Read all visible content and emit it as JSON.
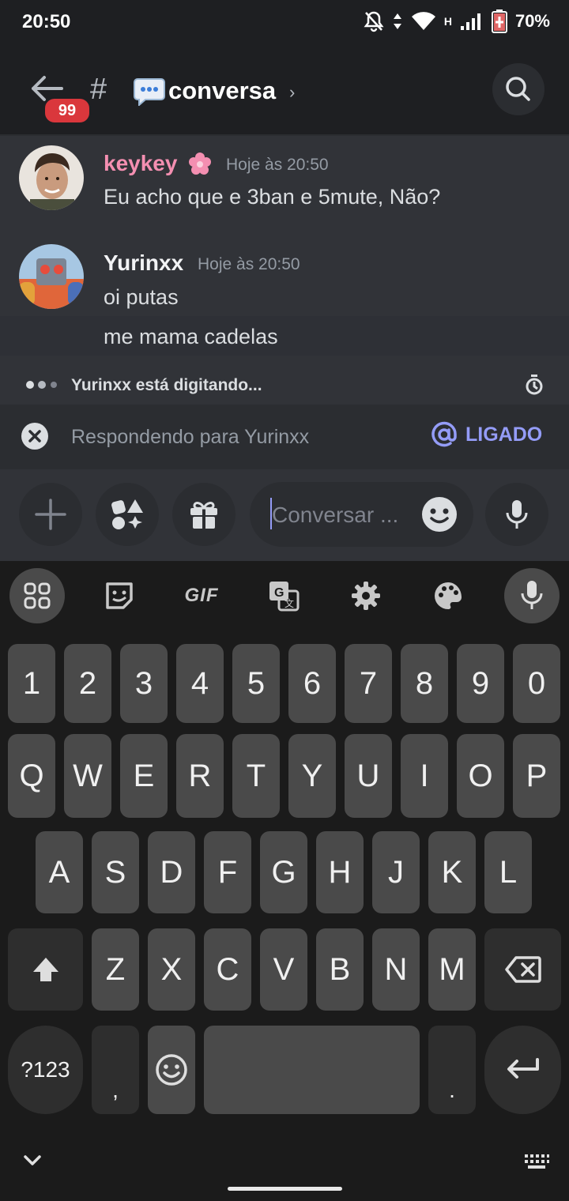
{
  "status_bar": {
    "time": "20:50",
    "network": "H",
    "battery": "70%"
  },
  "header": {
    "badge": "99",
    "hash": "#",
    "channel_name": "conversa",
    "chevron": "›"
  },
  "messages": [
    {
      "author": "keykey",
      "timestamp": "Hoje às 20:50",
      "lines": [
        "Eu acho que e 3ban e 5mute, Não?"
      ],
      "author_color": "#f48fb1"
    },
    {
      "author": "Yurinxx",
      "timestamp": "Hoje às 20:50",
      "lines": [
        "oi putas",
        "me mama cadelas"
      ],
      "author_color": "#f2f3f5"
    }
  ],
  "typing": {
    "text": "Yurinxx está digitando..."
  },
  "reply": {
    "text": "Respondendo para Yurinxx",
    "mention_label": "LIGADO"
  },
  "composer": {
    "placeholder": "Conversar ..."
  },
  "keyboard": {
    "toolbar": [
      "apps-icon",
      "sticker-icon",
      "GIF",
      "translate-icon",
      "settings-icon",
      "palette-icon",
      "mic-icon"
    ],
    "gif_label": "GIF",
    "row_numbers": [
      "1",
      "2",
      "3",
      "4",
      "5",
      "6",
      "7",
      "8",
      "9",
      "0"
    ],
    "row_q": [
      "Q",
      "W",
      "E",
      "R",
      "T",
      "Y",
      "U",
      "I",
      "O",
      "P"
    ],
    "row_a": [
      "A",
      "S",
      "D",
      "F",
      "G",
      "H",
      "J",
      "K",
      "L"
    ],
    "row_z": [
      "Z",
      "X",
      "C",
      "V",
      "B",
      "N",
      "M"
    ],
    "symbols_label": "?123",
    "comma": ",",
    "period": "."
  },
  "colors": {
    "accent": "#949cf7",
    "badge": "#da373c",
    "background": "#313338"
  }
}
